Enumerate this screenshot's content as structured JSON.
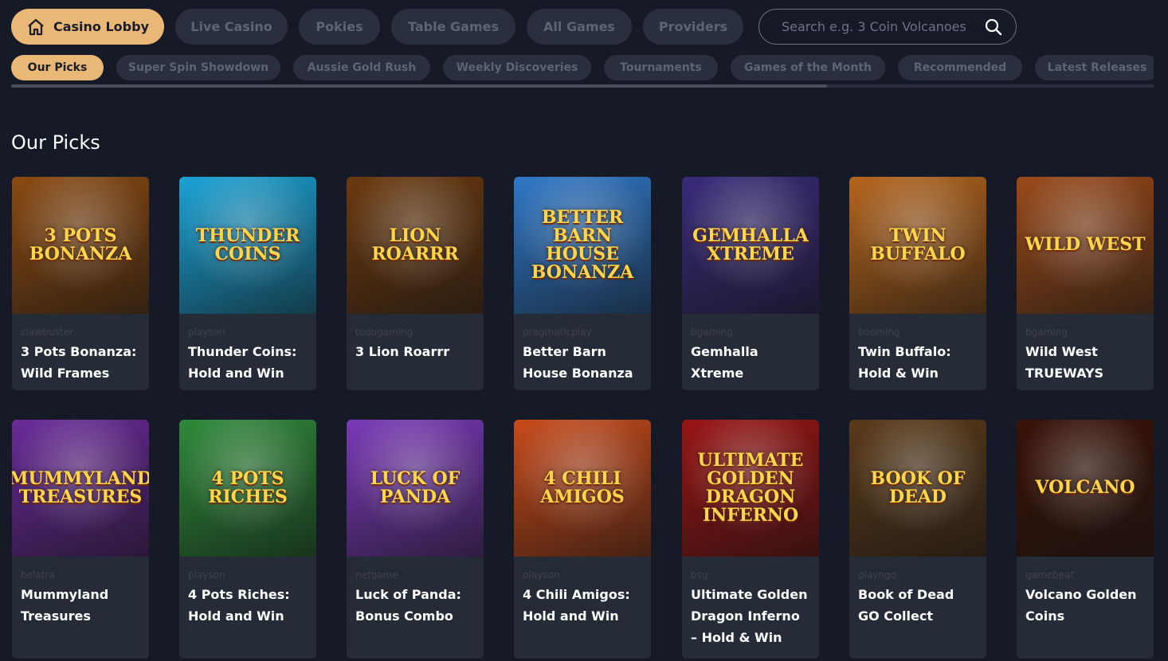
{
  "nav": {
    "tabs": [
      {
        "label": "Casino Lobby",
        "active": true
      },
      {
        "label": "Live Casino",
        "active": false
      },
      {
        "label": "Pokies",
        "active": false
      },
      {
        "label": "Table Games",
        "active": false
      },
      {
        "label": "All Games",
        "active": false
      },
      {
        "label": "Providers",
        "active": false
      }
    ],
    "search_placeholder": "Search e.g. 3 Coin Volcanoes"
  },
  "subnav": {
    "items": [
      {
        "label": "Our Picks",
        "active": true
      },
      {
        "label": "Super Spin Showdown",
        "active": false
      },
      {
        "label": "Aussie Gold Rush",
        "active": false
      },
      {
        "label": "Weekly Discoveries",
        "active": false
      },
      {
        "label": "Tournaments",
        "active": false
      },
      {
        "label": "Games of the Month",
        "active": false
      },
      {
        "label": "Recommended",
        "active": false
      },
      {
        "label": "Latest Releases",
        "active": false
      }
    ]
  },
  "section_title": "Our Picks",
  "colors": {
    "accent": "#e9b877",
    "background": "#161a26",
    "card": "#262b38",
    "pill": "#2a2f3d"
  },
  "games": [
    {
      "provider": "clawbuster",
      "name": "3 Pots Bonanza: Wild Frames",
      "thumb_text": "3 Pots Bonanza",
      "bg": "#8a4a12"
    },
    {
      "provider": "playson",
      "name": "Thunder Coins: Hold and Win",
      "thumb_text": "Thunder Coins",
      "bg": "#1aa3d6"
    },
    {
      "provider": "todogaming",
      "name": "3 Lion Roarrr",
      "thumb_text": "Lion Roarrr",
      "bg": "#6b3a10"
    },
    {
      "provider": "pragmaticplay",
      "name": "Better Barn House Bonanza",
      "thumb_text": "Better Barn House Bonanza",
      "bg": "#2f78c8"
    },
    {
      "provider": "bgaming",
      "name": "Gemhalla Xtreme",
      "thumb_text": "Gemhalla Xtreme",
      "bg": "#3a2a7a"
    },
    {
      "provider": "booming",
      "name": "Twin Buffalo: Hold & Win",
      "thumb_text": "Twin Buffalo",
      "bg": "#b5651d"
    },
    {
      "provider": "bgaming",
      "name": "Wild West TRUEWAYS",
      "thumb_text": "Wild West",
      "bg": "#9a4a1a"
    },
    {
      "provider": "belatra",
      "name": "Mummyland Treasures",
      "thumb_text": "Mummyland Treasures",
      "bg": "#6a2a9a"
    },
    {
      "provider": "playson",
      "name": "4 Pots Riches: Hold and Win",
      "thumb_text": "4 Pots Riches",
      "bg": "#2e8a3a"
    },
    {
      "provider": "netgame",
      "name": "Luck of Panda: Bonus Combo",
      "thumb_text": "Luck of Panda",
      "bg": "#7a3ab8"
    },
    {
      "provider": "playson",
      "name": "4 Chili Amigos: Hold and Win",
      "thumb_text": "4 Chili Amigos",
      "bg": "#c84a1a"
    },
    {
      "provider": "bsg",
      "name": "Ultimate Golden Dragon Inferno – Hold & Win",
      "thumb_text": "Ultimate Golden Dragon Inferno",
      "bg": "#9a1414"
    },
    {
      "provider": "playngo",
      "name": "Book of Dead GO Collect",
      "thumb_text": "Book of Dead",
      "bg": "#5a3a1a"
    },
    {
      "provider": "gamebeat",
      "name": "Volcano Golden Coins",
      "thumb_text": "Volcano",
      "bg": "#3a1208"
    }
  ]
}
